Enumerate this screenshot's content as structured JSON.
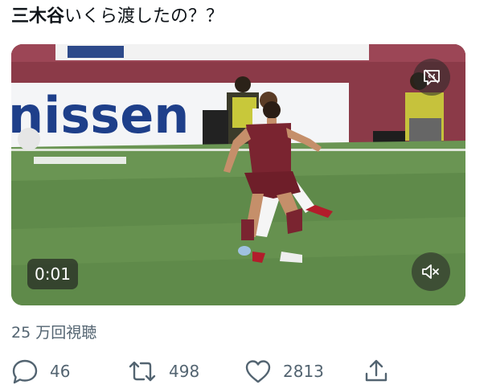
{
  "tweet": {
    "text_highlight": "三木谷",
    "text_rest": "いくら渡したの？？"
  },
  "video": {
    "timestamp": "0:01",
    "banner_text": "nissen"
  },
  "views": "25 万回視聴",
  "actions": {
    "replies": "46",
    "retweets": "498",
    "likes": "2813"
  },
  "colors": {
    "jersey": "#7a2430",
    "pitch": "#5f8a4a",
    "icon_gray": "#536471"
  }
}
